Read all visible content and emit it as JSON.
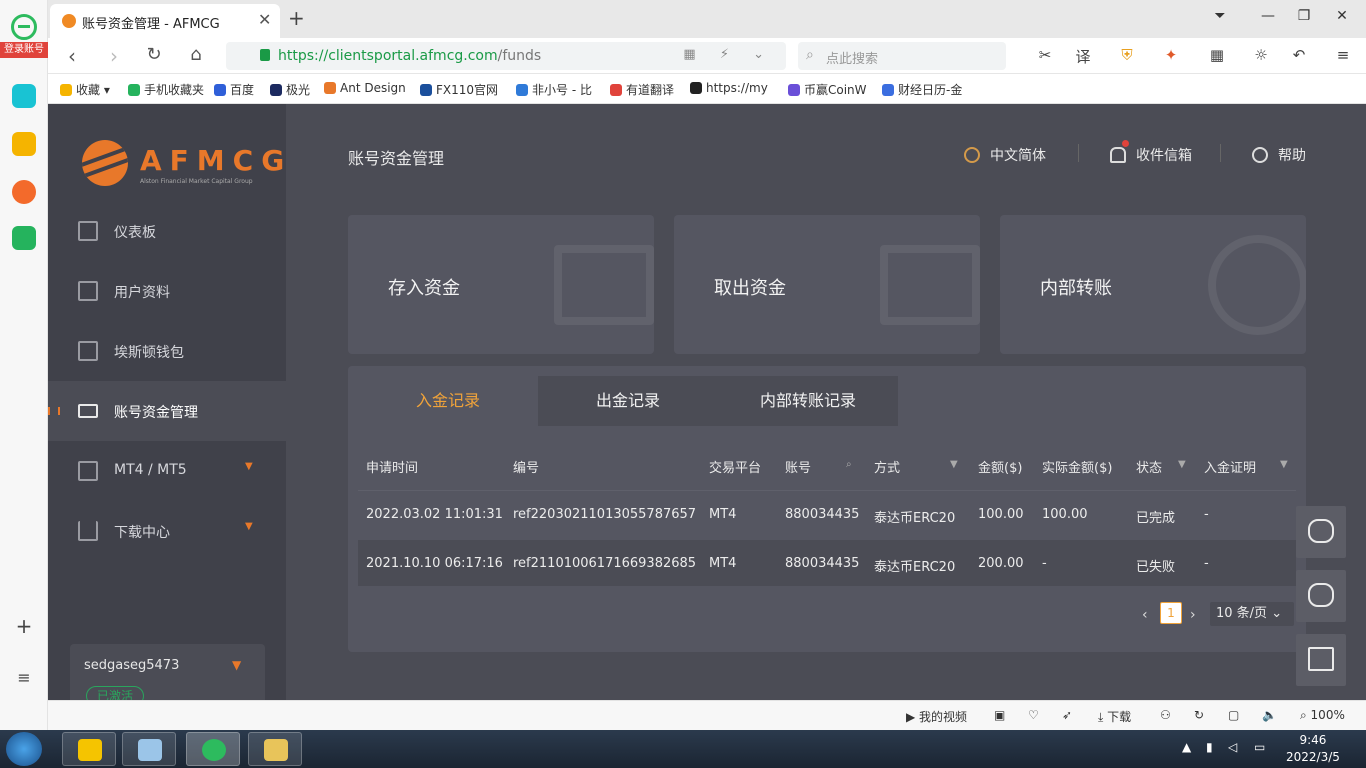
{
  "sidebar_browser": {
    "login_label": "登录账号",
    "tools": [
      "+",
      "≡"
    ]
  },
  "tab": {
    "title": "账号资金管理 - AFMCG",
    "close": "✕",
    "new": "+"
  },
  "window_controls": [
    "⏷",
    "—",
    "❐",
    "✕"
  ],
  "address": {
    "scheme": "https://",
    "host": "clientsportal.afmcg.com",
    "path": "/funds"
  },
  "search": {
    "placeholder": "点此搜索"
  },
  "bookmarks": [
    "收藏",
    "手机收藏夹",
    "百度",
    "极光",
    "Ant Design",
    "FX110官网",
    "非小号 - 比",
    "有道翻译",
    "https://my",
    "币赢CoinW",
    "财经日历-金"
  ],
  "app": {
    "brand": "AFMCG",
    "brand_sub": "Alston Financial Market Capital Group",
    "menu": [
      {
        "label": "仪表板"
      },
      {
        "label": "用户资料"
      },
      {
        "label": "埃斯顿钱包"
      },
      {
        "label": "账号资金管理"
      },
      {
        "label": "MT4 / MT5"
      },
      {
        "label": "下载中心"
      }
    ],
    "user": {
      "name": "sedgaseg5473",
      "status": "已激活"
    },
    "page_title": "账号资金管理",
    "header_links": {
      "language": "中文简体",
      "inbox": "收件信箱",
      "help": "帮助"
    },
    "cards": [
      "存入资金",
      "取出资金",
      "内部转账"
    ],
    "record_tabs": [
      "入金记录",
      "出金记录",
      "内部转账记录"
    ],
    "columns": [
      "申请时间",
      "编号",
      "交易平台",
      "账号",
      "方式",
      "金额($)",
      "实际金额($)",
      "状态",
      "入金证明"
    ],
    "rows": [
      [
        "2022.03.02 11:01:31",
        "ref22030211013055787657",
        "MT4",
        "880034435",
        "泰达币ERC20",
        "100.00",
        "100.00",
        "已完成",
        "-"
      ],
      [
        "2021.10.10 06:17:16",
        "ref21101006171669382685",
        "MT4",
        "880034435",
        "泰达币ERC20",
        "200.00",
        "-",
        "已失败",
        "-"
      ]
    ],
    "pager": {
      "current": "1",
      "page_size": "10 条/页"
    }
  },
  "statusbar": {
    "video": "我的视频",
    "download": "下载",
    "zoom": "100%"
  },
  "taskbar": {
    "time": "9:46",
    "date": "2022/3/5"
  }
}
